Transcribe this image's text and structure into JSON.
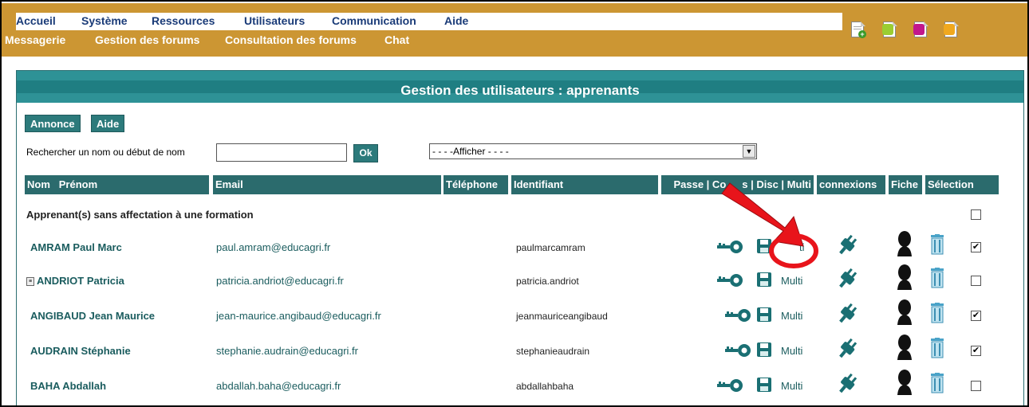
{
  "menu": {
    "top": [
      "Accueil",
      "Système",
      "Ressources",
      "Utilisateurs",
      "Communication",
      "Aide"
    ],
    "sub": [
      "Messagerie",
      "Gestion des forums",
      "Consultation des forums",
      "Chat"
    ]
  },
  "toolbar_icons": [
    "new-document-icon",
    "user-green-icon",
    "user-pink-icon",
    "user-orange-icon"
  ],
  "panel": {
    "title": "Gestion des utilisateurs : apprenants",
    "buttons": {
      "announce": "Annonce",
      "help": "Aide"
    },
    "search": {
      "label": "Rechercher un nom ou début de nom",
      "value": "",
      "ok": "Ok"
    },
    "select": {
      "value": "- - - -Afficher - - - -"
    },
    "headers": {
      "name": "Nom",
      "firstname": "Prénom",
      "email": "Email",
      "phone": "Téléphone",
      "identifier": "Identifiant",
      "actions": "Passe | Co",
      "actions_tail": "s | Disc | Multi",
      "connections": "connexions",
      "sheet": "Fiche",
      "selection": "Sélection"
    },
    "group_label": "Apprenant(s) sans affectation à une formation",
    "rows": [
      {
        "name": "AMRAM Paul Marc",
        "email": "paul.amram@educagri.fr",
        "identifier": "paulmarcamram",
        "multi": "ti",
        "selected": true
      },
      {
        "name": "ANDRIOT Patricia",
        "email": "patricia.andriot@educagri.fr",
        "identifier": "patricia.andriot",
        "multi": "Multi",
        "selected": false,
        "has_note": true
      },
      {
        "name": "ANGIBAUD Jean Maurice",
        "email": "jean-maurice.angibaud@educagri.fr",
        "identifier": "jeanmauriceangibaud",
        "multi": "Multi",
        "selected": true
      },
      {
        "name": "AUDRAIN Stéphanie",
        "email": "stephanie.audrain@educagri.fr",
        "identifier": "stephanieaudrain",
        "multi": "Multi",
        "selected": true
      },
      {
        "name": "BAHA Abdallah",
        "email": "abdallah.baha@educagri.fr",
        "identifier": "abdallahbaha",
        "multi": "Multi",
        "selected": false
      }
    ]
  },
  "colors": {
    "accent_teal": "#2b6b6d",
    "menu_gold": "#cc9633",
    "annotation_red": "#e8141b"
  }
}
